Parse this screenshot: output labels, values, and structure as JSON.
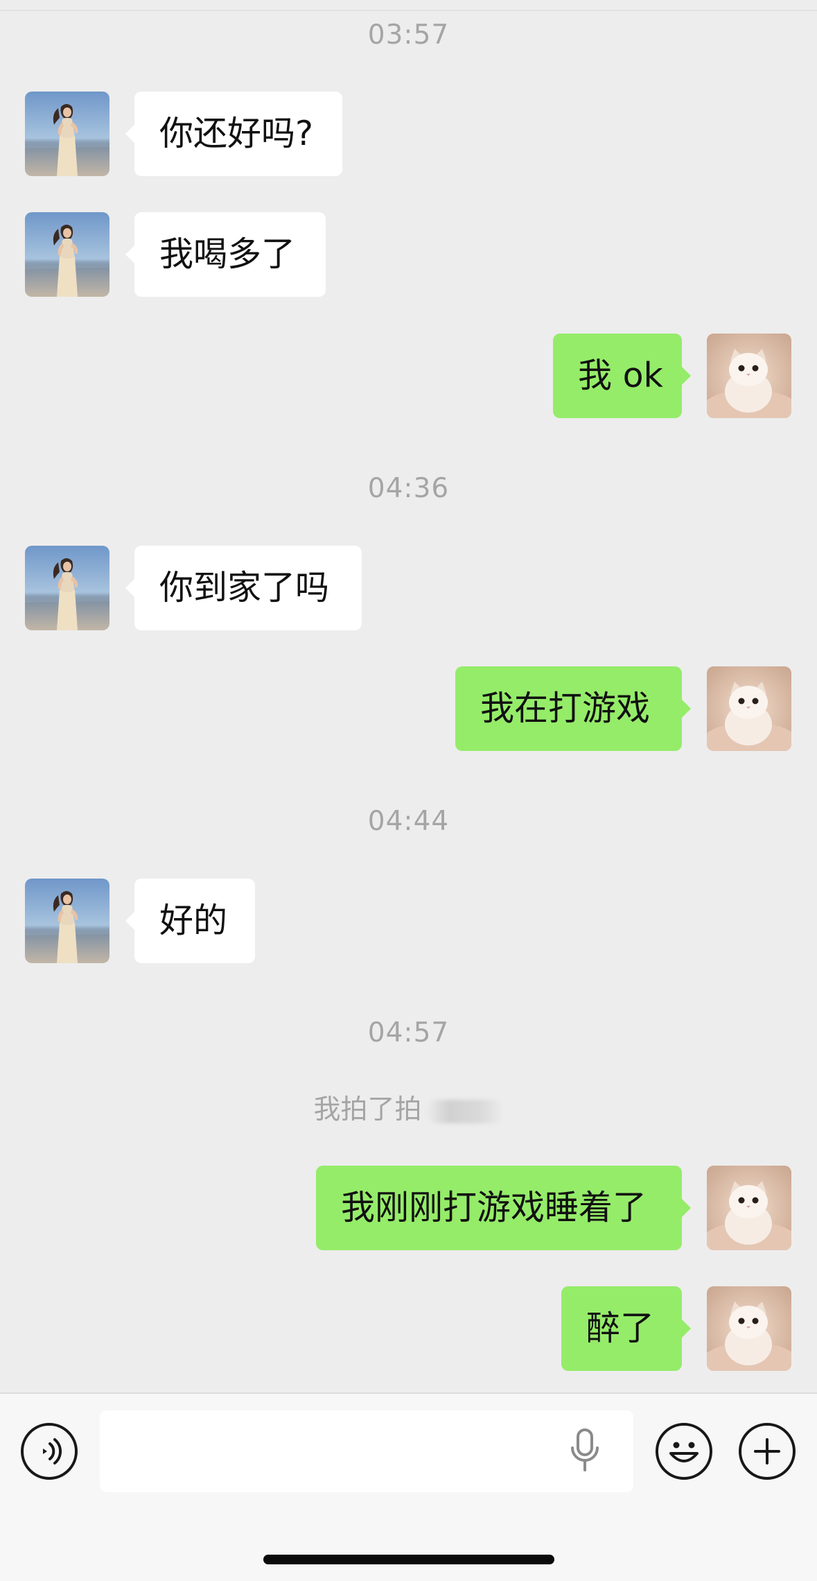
{
  "colors": {
    "background": "#ededed",
    "incoming_bubble": "#ffffff",
    "outgoing_bubble": "#95ec69",
    "timestamp_text": "#a5a5a5"
  },
  "messages": {
    "time_1": "03:57",
    "msg_1": "你还好吗?",
    "msg_2": "我喝多了",
    "msg_3": "我 ok",
    "time_2": "04:36",
    "msg_4": "你到家了吗",
    "msg_5": "我在打游戏",
    "time_3": "04:44",
    "msg_6": "好的",
    "time_4": "04:57",
    "system_pat": "我拍了拍",
    "msg_7": "我刚刚打游戏睡着了",
    "msg_8": "醉了"
  },
  "input_bar": {
    "left_icon": "voice-mode-icon",
    "field_icon": "microphone-icon",
    "emoji_icon": "emoji-icon",
    "plus_icon": "plus-icon"
  }
}
